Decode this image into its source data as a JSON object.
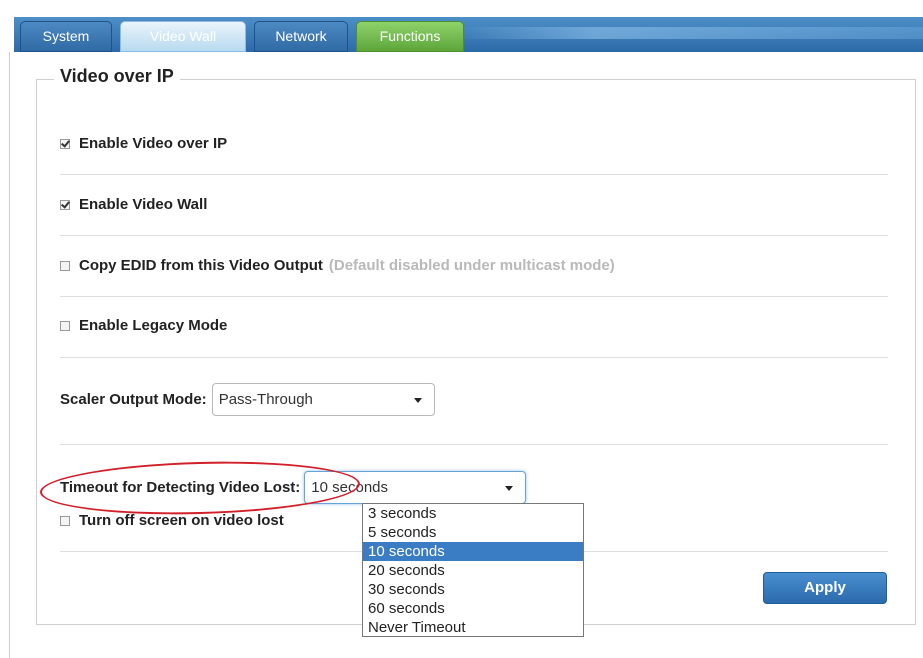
{
  "tabs": [
    {
      "label": "System"
    },
    {
      "label": "Video Wall"
    },
    {
      "label": "Network"
    },
    {
      "label": "Functions"
    }
  ],
  "panel": {
    "legend": "Video over IP",
    "enable_video_over_ip": {
      "label": "Enable Video over IP",
      "checked": true
    },
    "enable_video_wall": {
      "label": "Enable Video Wall",
      "checked": true
    },
    "copy_edid": {
      "label": "Copy EDID from this Video Output",
      "hint": "(Default disabled under multicast mode)",
      "checked": false
    },
    "legacy_mode": {
      "label": "Enable Legacy Mode",
      "checked": false
    },
    "scaler": {
      "label": "Scaler Output Mode:",
      "value": "Pass-Through"
    },
    "timeout": {
      "label": "Timeout for Detecting Video Lost:",
      "value": "10 seconds",
      "options": [
        "3 seconds",
        "5 seconds",
        "10 seconds",
        "20 seconds",
        "30 seconds",
        "60 seconds",
        "Never Timeout"
      ],
      "selected": "10 seconds"
    },
    "turn_off_screen": {
      "label": "Turn off screen on video lost",
      "checked": false
    },
    "apply_label": "Apply"
  },
  "colors": {
    "tab_blue": "#2f6aa4",
    "tab_functions": "#5da63a",
    "highlight": "#3b7dc4",
    "annotation_red": "#d2202a"
  }
}
